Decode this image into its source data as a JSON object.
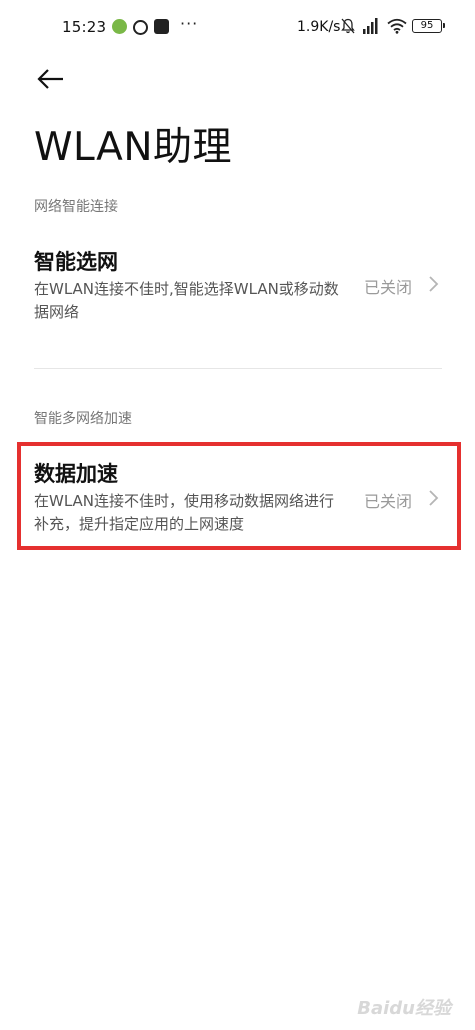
{
  "status_bar": {
    "time": "15:23",
    "dots": "···",
    "network_speed": "1.9K/s",
    "battery": "95"
  },
  "header": {
    "back_icon": "back-arrow-icon",
    "title": "WLAN助理"
  },
  "sections": [
    {
      "header": "网络智能连接",
      "item": {
        "title": "智能选网",
        "description": "在WLAN连接不佳时,智能选择WLAN或移动数据网络",
        "status": "已关闭"
      }
    },
    {
      "header": "智能多网络加速",
      "item": {
        "title": "数据加速",
        "description": "在WLAN连接不佳时，使用移动数据网络进行补充，提升指定应用的上网速度",
        "status": "已关闭"
      }
    }
  ],
  "annotation": {
    "highlight_color": "#e5302f"
  },
  "watermark": "Baidu经验",
  "colors": {
    "background": "#ffffff",
    "title_text": "#111111",
    "secondary_text": "#555555",
    "status_text": "#9a9a9a"
  }
}
